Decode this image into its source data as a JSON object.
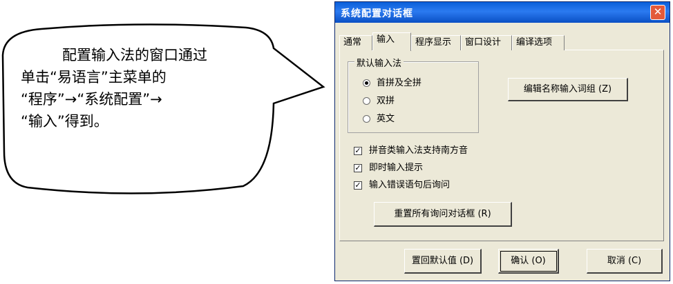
{
  "callout": {
    "lines": [
      "配置输入法的窗口通过",
      "单击“易语言”主菜单的",
      "“程序”→“系统配置”→",
      "“输入”得到。"
    ]
  },
  "dialog": {
    "title": "系统配置对话框",
    "close_glyph": "✕",
    "tabs": [
      "通常",
      "输入",
      "程序显示",
      "窗口设计",
      "编译选项"
    ],
    "active_tab": "输入",
    "group": {
      "title": "默认输入法",
      "options": [
        {
          "label": "首拼及全拼",
          "selected": true
        },
        {
          "label": "双拼",
          "selected": false
        },
        {
          "label": "英文",
          "selected": false
        }
      ]
    },
    "edit_phrase_button": "编辑名称输入词组 (Z)",
    "checkboxes": [
      {
        "label": "拼音类输入法支持南方音",
        "checked": true
      },
      {
        "label": "即时输入提示",
        "checked": true
      },
      {
        "label": "输入错误语句后询问",
        "checked": true
      }
    ],
    "check_glyph": "✓",
    "reset_dialogs_button": "重置所有询问对话框 (R)",
    "restore_defaults_button": "置回默认值 (D)",
    "ok_button": "确认 (O)",
    "cancel_button": "取消 (C)"
  }
}
